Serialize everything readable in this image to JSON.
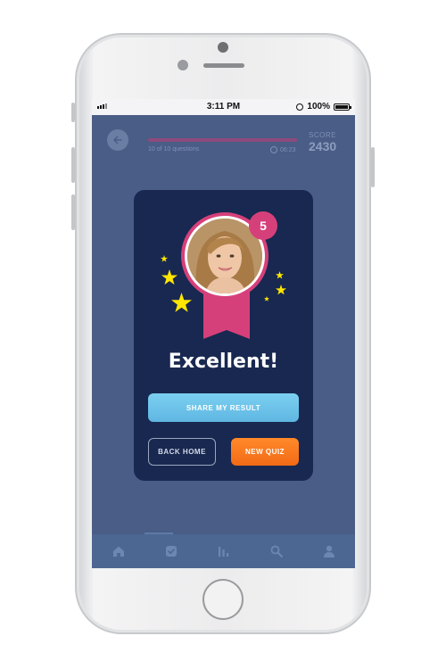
{
  "statusbar": {
    "time": "3:11 PM",
    "battery": "100%"
  },
  "quiz_header": {
    "progress_text": "10 of 10 questions",
    "progress_fraction": 1.0,
    "timer": "06:23",
    "score_label": "SCORE",
    "score_value": "2430"
  },
  "result_card": {
    "level": "5",
    "title": "Excellent!",
    "share_label": "SHARE MY RESULT",
    "back_home_label": "BACK HOME",
    "new_quiz_label": "NEW QUIZ"
  },
  "tabbar": {
    "tabs": [
      "home-icon",
      "check-icon",
      "stats-icon",
      "search-icon",
      "profile-icon"
    ]
  },
  "colors": {
    "screen_bg": "#4a5d86",
    "card_bg": "#182850",
    "accent_pink": "#d6407a",
    "share_blue": "#6cc3eb",
    "quiz_orange": "#f77a1f",
    "star_yellow": "#ffe600"
  }
}
